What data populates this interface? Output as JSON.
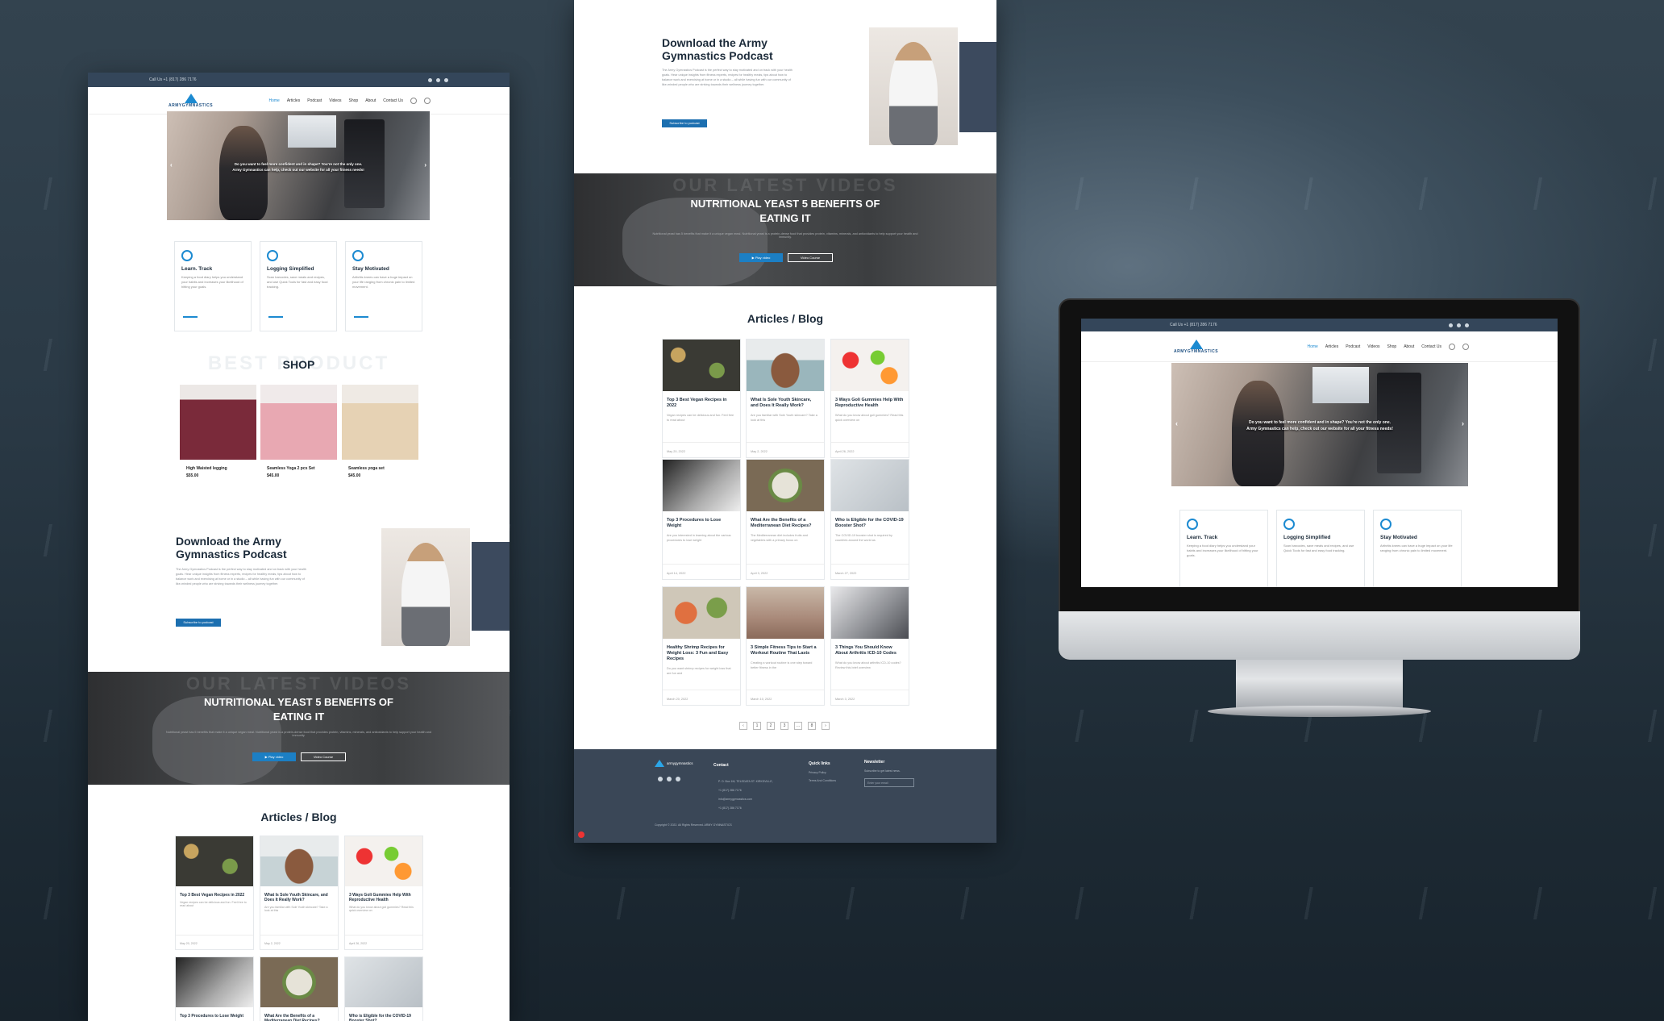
{
  "topbar": {
    "phone": "Call Us +1 (817) 286 7176"
  },
  "nav": {
    "logo": "ARMYGYMNASTICS",
    "items": [
      "Home",
      "Articles",
      "Podcast",
      "Videos",
      "Shop",
      "About",
      "Contact Us"
    ]
  },
  "hero": {
    "caption_line1": "Do you want to feel more confident and in shape? You're not the only one.",
    "caption_line2": "Army Gymnastics can help, check out our website for all your fitness needs!",
    "prev": "‹",
    "next": "›"
  },
  "features": [
    {
      "title": "Learn. Track",
      "text": "Keeping a food diary helps you understand your habits and increases your likelihood of hitting your goals."
    },
    {
      "title": "Logging Simplified",
      "text": "Scan barcodes, save meals and recipes, and use Quick Tools for fast and easy food tracking."
    },
    {
      "title": "Stay Motivated",
      "text": "Arthritis knees can have a huge impact on your life ranging from chronic pain to limited movement."
    }
  ],
  "shop": {
    "heading": "SHOP",
    "ghost": "BEST PRODUCT",
    "products": [
      {
        "name": "High Waisted legging",
        "price": "$55.00"
      },
      {
        "name": "Seamless Yoga 2 pcs Set",
        "price": "$45.00"
      },
      {
        "name": "Seamless yoga set",
        "price": "$45.00"
      }
    ]
  },
  "podcast": {
    "title_line1": "Download the Army",
    "title_line2": "Gymnastics Podcast",
    "text": "The Army Gymnastics Podcast is the perfect way to stay motivated and on track with your health goals. Hear unique insights from fitness experts, recipes for healthy meals, tips about how to balance work and exercising at home or in a studio – all while having fun with our community of like-minded people who are striving towards their wellness journey together.",
    "button": "Subscribe to podcast"
  },
  "yeast": {
    "title_line1": "NUTRITIONAL YEAST 5 BENEFITS OF",
    "title_line2": "EATING IT",
    "ghost": "OUR LATEST VIDEOS",
    "text": "Nutritional yeast has 5 benefits that make it a unique vegan meal. Nutritional yeast is a protein-dense food that provides protein, vitamins, minerals, and antioxidants to help support your health and immunity.",
    "play": "▶ Play video",
    "course": "Video Course"
  },
  "articles": {
    "heading": "Articles / Blog",
    "cards": [
      {
        "title": "Top 3 Best Vegan Recipes in 2022",
        "text": "Vegan recipes can be delicious and fun. Feel free to read about",
        "date": "May 20, 2022"
      },
      {
        "title": "What Is Sole Youth Skincare, and Does It Really Work?",
        "text": "Are you familiar with Sole Youth skincare? Take a look at this",
        "date": "May 2, 2022"
      },
      {
        "title": "3 Ways Goli Gummies Help With Reproductive Health",
        "text": "What do you know about goli gummies? Read this quick overview on",
        "date": "April 26, 2022"
      },
      {
        "title": "Top 3 Procedures to Lose Weight",
        "text": "Are you interested in learning about the various procedures to lose weight",
        "date": "April 14, 2022"
      },
      {
        "title": "What Are the Benefits of a Mediterranean Diet Recipes?",
        "text": "The Mediterranean diet includes fruits and vegetables with a primary focus on",
        "date": "April 3, 2022"
      },
      {
        "title": "Who is Eligible for the COVID-19 Booster Shot?",
        "text": "The COVID-19 booster shot is required by countries around the world as",
        "date": "March 27, 2022"
      },
      {
        "title": "Healthy Shrimp Recipes for Weight Loss: 3 Fun and Easy Recipes",
        "text": "Do you want shrimp recipes for weight loss that are fun and",
        "date": "March 20, 2022"
      },
      {
        "title": "3 Simple Fitness Tips to Start a Workout Routine That Lasts",
        "text": "Creating a workout routine is one step toward better fitness in the",
        "date": "March 10, 2022"
      },
      {
        "title": "3 Things You Should Know About Arthritis ICD-10 Codes",
        "text": "What do you know about arthritis ICD-10 codes? Review this brief overview",
        "date": "March 3, 2022"
      }
    ],
    "pages": [
      "‹",
      "1",
      "2",
      "3",
      "…",
      "8",
      "›"
    ]
  },
  "footer": {
    "logo": "armygymnastics",
    "contact_h": "Contact",
    "contact": [
      "P. O. Box 1M, TELEDATA ST. KIRKSVILLE,",
      "+1 (817) 286 7176",
      "info@armygymnastics.com",
      "+1 (817) 286 7176"
    ],
    "quick_h": "Quick links",
    "quick": [
      "Privacy Policy",
      "Terms And Conditions"
    ],
    "news_h": "Newsletter",
    "news_text": "Subscribe to get latest news.",
    "news_ph": "Enter your email",
    "copy": "Copyright © 2022. All Rights Reserved. ARMY GYMNASTICS"
  },
  "colors": {
    "accent": "#1c8ad1",
    "navy": "#34465a",
    "button": "#1c6fb0"
  }
}
